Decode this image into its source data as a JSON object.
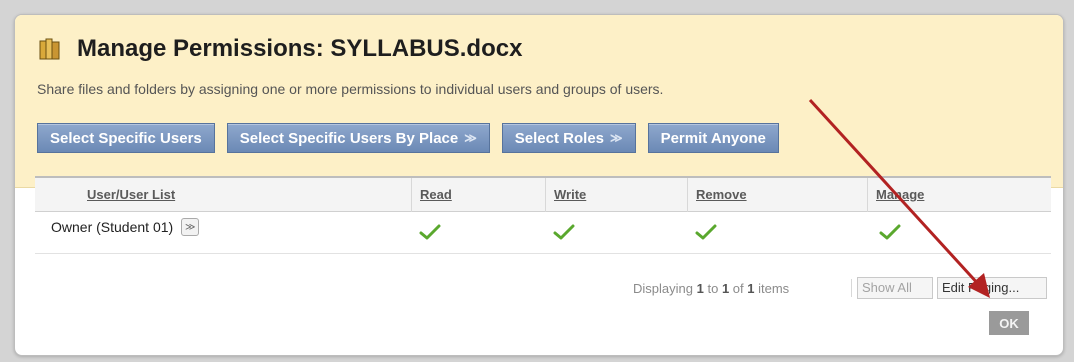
{
  "header": {
    "title": "Manage Permissions: SYLLABUS.docx",
    "subtitle": "Share files and folders by assigning one or more permissions to individual users and groups of users.",
    "title_icon": "document-stack-icon"
  },
  "buttons": {
    "select_specific_users": "Select Specific Users",
    "select_by_place": "Select Specific Users By Place",
    "select_roles": "Select Roles",
    "permit_anyone": "Permit Anyone",
    "chevron": "≫"
  },
  "table": {
    "columns": [
      "User/User List",
      "Read",
      "Write",
      "Remove",
      "Manage"
    ],
    "rows": [
      {
        "user": "Owner (Student 01)",
        "read": true,
        "write": true,
        "remove": true,
        "manage": true
      }
    ]
  },
  "paging": {
    "prefix": "Displaying",
    "from": "1",
    "to_word": "to",
    "to": "1",
    "of_word": "of",
    "total": "1",
    "suffix": "items",
    "show_all": "Show All",
    "edit_paging": "Edit Paging..."
  },
  "footer": {
    "ok_label": "OK"
  },
  "colors": {
    "header_bg": "#fdf0c7",
    "button_blue": "#6b89b5",
    "check_green": "#5aa82e",
    "annotation_arrow": "#b22222"
  }
}
